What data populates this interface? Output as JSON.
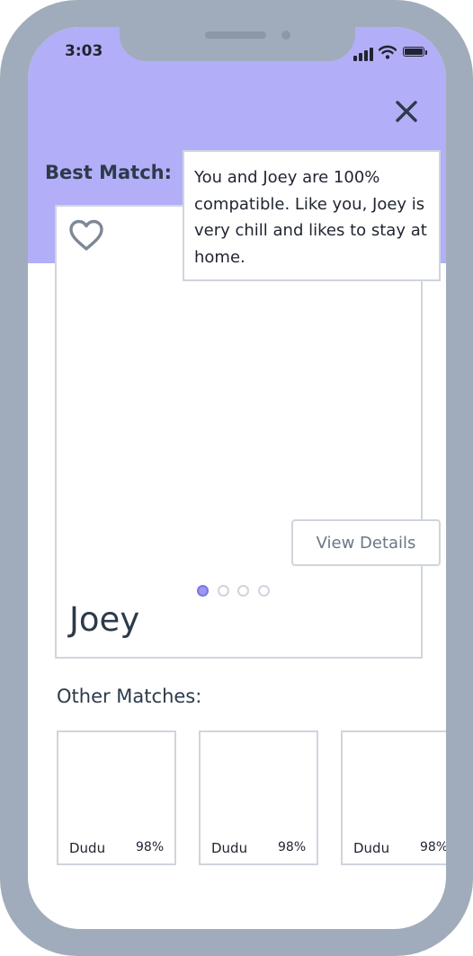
{
  "status_bar": {
    "time": "3:03"
  },
  "best_match": {
    "label": "Best Match:",
    "name": "Joey",
    "compatibility_text": "You and Joey are 100%\ncompatible. Like you, Joey is\nvery chill and likes to stay at\nhome.",
    "view_details_label": "View Details",
    "photo_count": 4,
    "active_photo_index": 0
  },
  "other_matches": {
    "label": "Other Matches:",
    "items": [
      {
        "name": "Dudu",
        "percent": "98%"
      },
      {
        "name": "Dudu",
        "percent": "98%"
      },
      {
        "name": "Dudu",
        "percent": "98%"
      }
    ]
  },
  "colors": {
    "header_accent": "#b2aef7",
    "frame": "#a0acbb",
    "active_dot": "#9d97f0",
    "text_dark": "#2d3a4a"
  }
}
